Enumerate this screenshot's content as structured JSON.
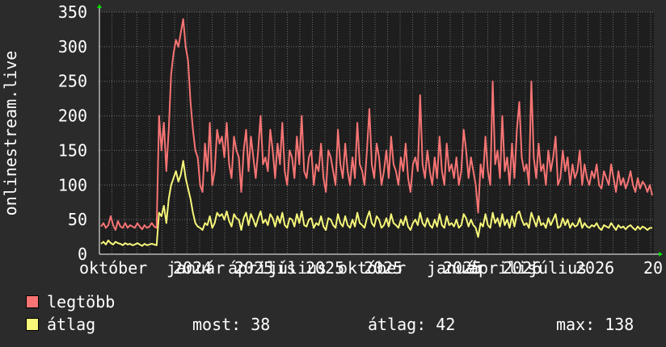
{
  "chart_data": {
    "type": "line",
    "ylabel": "onlinestream.live",
    "ylim": [
      0,
      350
    ],
    "yticks": [
      0,
      50,
      100,
      150,
      200,
      250,
      300,
      350
    ],
    "x_tick_labels": [
      "október",
      "január",
      "2024",
      "április",
      "2025",
      "július",
      "2025",
      "október",
      "2025",
      "január",
      "2025",
      "április",
      "2026",
      "július",
      "2026",
      "20"
    ],
    "grid": true,
    "colors": {
      "legtobb": "#f87474",
      "atlag": "#f7f77a",
      "background": "#2b2b2b",
      "plot": "#1e1e1e",
      "grid": "#6e6e6e",
      "axis_arrow": "#00e000"
    },
    "series": [
      {
        "name": "legtöbb",
        "values": [
          40,
          45,
          38,
          42,
          55,
          42,
          35,
          48,
          40,
          38,
          45,
          38,
          42,
          40,
          38,
          45,
          40,
          36,
          42,
          38,
          40,
          45,
          40,
          38,
          200,
          150,
          190,
          120,
          180,
          260,
          290,
          310,
          300,
          320,
          340,
          300,
          280,
          220,
          180,
          150,
          140,
          100,
          90,
          160,
          120,
          190,
          100,
          120,
          180,
          160,
          170,
          140,
          190,
          130,
          110,
          170,
          150,
          140,
          90,
          150,
          180,
          120,
          170,
          140,
          110,
          150,
          200,
          130,
          140,
          120,
          180,
          150,
          110,
          160,
          130,
          190,
          120,
          100,
          150,
          140,
          110,
          170,
          130,
          200,
          120,
          110,
          140,
          150,
          100,
          130,
          120,
          160,
          110,
          90,
          150,
          140,
          120,
          100,
          180,
          130,
          110,
          160,
          120,
          100,
          140,
          110,
          190,
          130,
          120,
          100,
          150,
          210,
          130,
          110,
          160,
          140,
          100,
          120,
          150,
          110,
          170,
          130,
          120,
          100,
          140,
          120,
          160,
          110,
          90,
          130,
          140,
          120,
          230,
          130,
          110,
          150,
          120,
          100,
          140,
          110,
          170,
          120,
          100,
          160,
          120,
          130,
          110,
          140,
          100,
          120,
          180,
          150,
          110,
          140,
          120,
          100,
          60,
          130,
          110,
          170,
          120,
          100,
          250,
          130,
          150,
          110,
          200,
          120,
          140,
          100,
          160,
          110,
          180,
          220,
          140,
          120,
          130,
          100,
          250,
          140,
          110,
          160,
          120,
          130,
          100,
          150,
          120,
          140,
          170,
          100,
          110,
          150,
          120,
          140,
          100,
          130,
          110,
          120,
          150,
          100,
          130,
          110,
          100,
          120,
          110,
          130,
          100,
          95,
          120,
          110,
          100,
          130,
          110,
          90,
          120,
          100,
          110,
          95,
          105,
          120,
          100,
          90,
          110,
          95,
          105,
          100,
          90,
          100,
          85
        ]
      },
      {
        "name": "átlag",
        "values": [
          15,
          18,
          14,
          20,
          16,
          14,
          18,
          16,
          15,
          13,
          16,
          14,
          15,
          13,
          14,
          16,
          14,
          12,
          15,
          13,
          14,
          15,
          14,
          13,
          60,
          55,
          70,
          45,
          80,
          100,
          110,
          120,
          105,
          115,
          135,
          110,
          95,
          80,
          60,
          45,
          40,
          38,
          35,
          45,
          42,
          55,
          38,
          45,
          60,
          55,
          58,
          50,
          62,
          48,
          40,
          58,
          52,
          50,
          35,
          52,
          60,
          42,
          58,
          50,
          40,
          52,
          62,
          45,
          50,
          42,
          58,
          52,
          40,
          55,
          45,
          60,
          42,
          38,
          52,
          50,
          40,
          58,
          45,
          62,
          42,
          40,
          50,
          52,
          38,
          45,
          42,
          55,
          40,
          35,
          52,
          50,
          42,
          38,
          58,
          45,
          40,
          55,
          42,
          38,
          50,
          40,
          60,
          45,
          42,
          38,
          52,
          62,
          45,
          40,
          55,
          50,
          38,
          42,
          52,
          40,
          58,
          45,
          42,
          38,
          50,
          42,
          55,
          40,
          35,
          45,
          50,
          42,
          60,
          45,
          40,
          52,
          42,
          38,
          50,
          40,
          58,
          42,
          38,
          55,
          42,
          45,
          40,
          50,
          38,
          42,
          58,
          52,
          40,
          50,
          42,
          38,
          25,
          45,
          40,
          58,
          42,
          38,
          60,
          45,
          52,
          40,
          58,
          42,
          50,
          38,
          55,
          40,
          58,
          62,
          50,
          42,
          45,
          38,
          60,
          50,
          40,
          55,
          42,
          45,
          38,
          52,
          42,
          50,
          58,
          38,
          40,
          52,
          42,
          50,
          38,
          45,
          40,
          42,
          52,
          38,
          45,
          40,
          38,
          42,
          40,
          45,
          38,
          35,
          42,
          40,
          38,
          45,
          40,
          35,
          42,
          38,
          40,
          36,
          40,
          42,
          38,
          35,
          40,
          36,
          40,
          38,
          35,
          38,
          38
        ]
      }
    ]
  },
  "legend": {
    "items": [
      {
        "name": "legtöbb",
        "color": "#f87474"
      },
      {
        "name": "átlag",
        "color": "#f7f77a"
      }
    ],
    "stats": {
      "most": "most: 38",
      "atlag": "átlag: 42",
      "max": "max: 138"
    }
  }
}
